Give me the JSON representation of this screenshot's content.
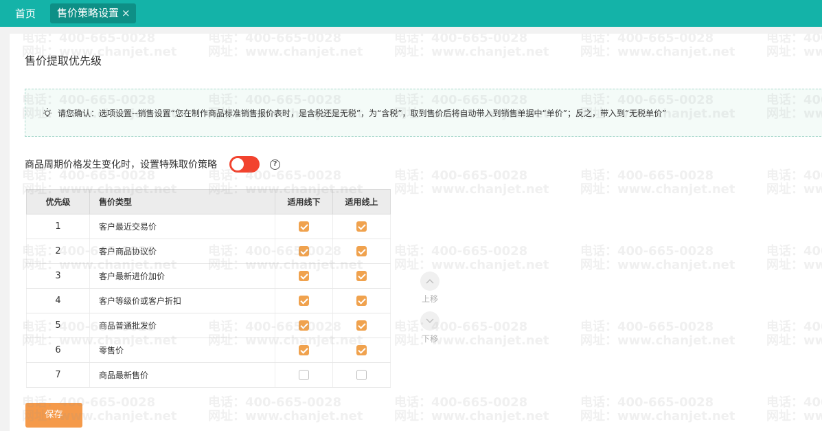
{
  "nav": {
    "home_label": "首页",
    "active_tab_label": "售价策略设置",
    "close_glyph": "×"
  },
  "page": {
    "section_title": "售价提取优先级",
    "notice_text": "请您确认：选项设置--销售设置“您在制作商品标准销售报价表时，是含税还是无税”，为“含税”，取到售价后将自动带入到销售单据中“单价”；反之，带入到“无税单价”",
    "rule_label": "商品周期价格发生变化时，设置特殊取价策略",
    "rule_toggle_on": true,
    "help_glyph": "?",
    "move_up_label": "上移",
    "move_down_label": "下移",
    "save_label": "保存"
  },
  "table": {
    "headers": [
      "优先级",
      "售价类型",
      "适用线下",
      "适用线上"
    ],
    "rows": [
      {
        "priority": "1",
        "type": "客户最近交易价",
        "offline": true,
        "online": true
      },
      {
        "priority": "2",
        "type": "客户商品协议价",
        "offline": true,
        "online": true
      },
      {
        "priority": "3",
        "type": "客户最新进价加价",
        "offline": true,
        "online": true
      },
      {
        "priority": "4",
        "type": "客户等级价或客户折扣",
        "offline": true,
        "online": true
      },
      {
        "priority": "5",
        "type": "商品普通批发价",
        "offline": true,
        "online": true
      },
      {
        "priority": "6",
        "type": "零售价",
        "offline": true,
        "online": true
      },
      {
        "priority": "7",
        "type": "商品最新售价",
        "offline": false,
        "online": false
      }
    ]
  },
  "watermark": {
    "phone": "电话：400-665-0028",
    "site": "网址：www.chanjet.net"
  },
  "colors": {
    "topbar": "#14b3a8",
    "active_tab": "#0e8f86",
    "toggle_on": "#f2432e",
    "checkbox_on": "#f0a24e",
    "save_button": "#f59a4a"
  }
}
